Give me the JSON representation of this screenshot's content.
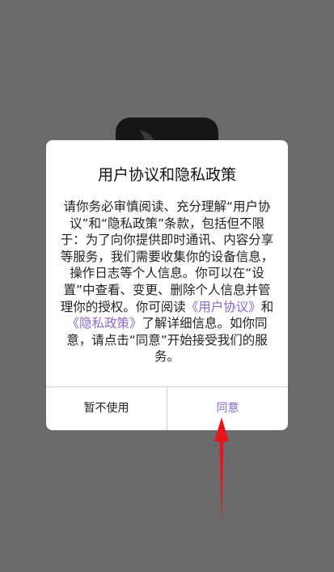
{
  "dialog": {
    "title": "用户协议和隐私政策",
    "body": {
      "text_1": "请你务必审慎阅读、充分理解“用户协议”和“隐私政策”条款，包括但不限于：为了向你提供即时通讯、内容分享等服务，我们需要收集你的设备信息，操作日志等个人信息。你可以在“设置”中查看、变更、删除个人信息并管理你的授权。你可阅读",
      "link_user_agreement": "《用户协议》",
      "text_2": "和",
      "link_privacy_policy": "《隐私政策》",
      "text_3": "了解详细信息。如你同意，请点击“同意”开始接受我们的服务。"
    },
    "buttons": {
      "cancel_label": "暂不使用",
      "agree_label": "同意"
    }
  },
  "colors": {
    "overlay": "#6b6b6b",
    "dialog_bg": "#ffffff",
    "accent": "#8a67c9",
    "annotation_arrow": "#e8141b"
  },
  "icons": {
    "background_app": "app-icon",
    "annotation": "red-arrow-icon"
  }
}
